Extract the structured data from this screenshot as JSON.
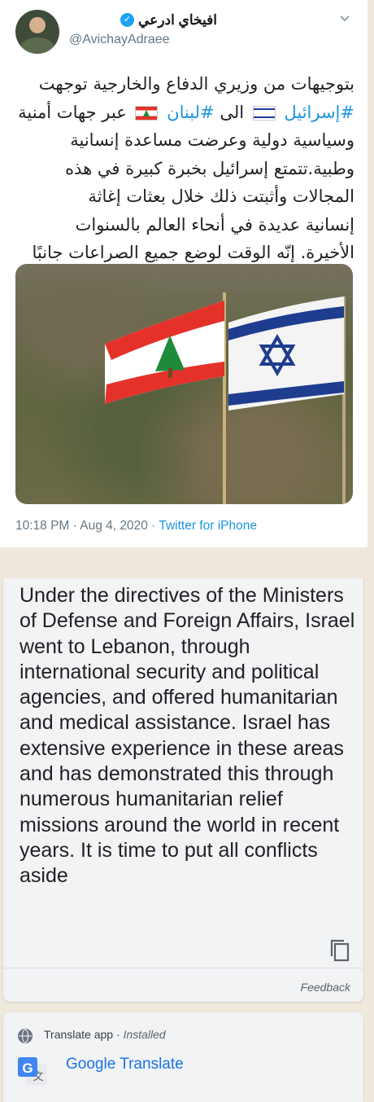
{
  "tweet": {
    "display_name": "افيخاي ادرعي",
    "handle": "@AvichayAdraee",
    "text_lines": [
      "بتوجيهات من وزيري الدفاع والخارجية توجهت",
      "#إسرائيل 🇮🇱 الى #لبنان 🇱🇧 عبر جهات أمنية",
      "وسياسية دولية وعرضت مساعدة إنسانية",
      "وطبية.تتمتع إسرائيل بخبرة كبيرة في هذه",
      "المجالات وأثبتت ذلك خلال بعثات إغاثة",
      "إنسانية عديدة في أنحاء العالم بالسنوات",
      "الأخيرة. إنّه الوقت لوضع جميع الصراعات جانبًا"
    ],
    "tag_israel": "#إسرائيل",
    "tag_lebanon": "#لبنان",
    "word_to": "الى",
    "line2_rest": "عبر جهات أمنية",
    "time": "10:18 PM · Aug 4, 2020 · ",
    "source": "Twitter for iPhone",
    "icons": {
      "verified": "verified-badge-icon",
      "menu": "chevron-down-icon"
    }
  },
  "translation": {
    "text": "Under the directives of the Ministers of Defense and Foreign Affairs, Israel went to Lebanon, through international security and political agencies, and offered humanitarian and medical assistance. Israel has extensive experience in these areas and has demonstrated this through numerous humanitarian relief missions around the world in recent years. It is time to put all conflicts aside",
    "feedback": "Feedback"
  },
  "app": {
    "label": "Translate app · ",
    "status": "Installed",
    "name": "Google Translate"
  },
  "colors": {
    "link": "#1b95e0",
    "app_link": "#1a73e8",
    "background": "#efe8dc"
  }
}
